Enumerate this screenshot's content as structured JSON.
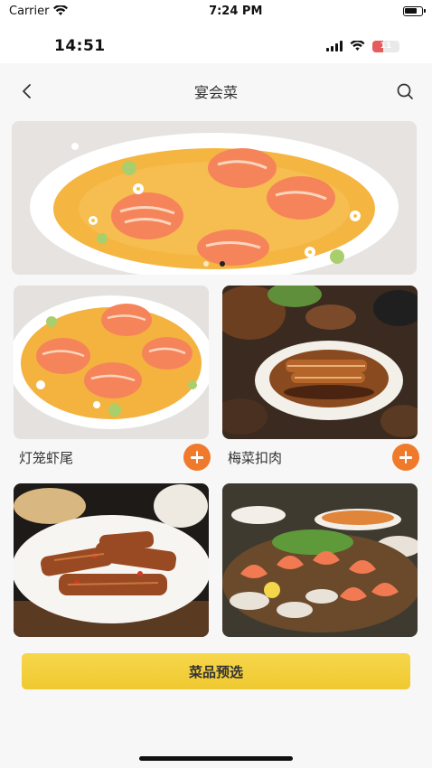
{
  "simulator_bar": {
    "carrier": "Carrier",
    "time": "7:24 PM"
  },
  "status_bar": {
    "time": "14:51",
    "battery": "11"
  },
  "nav": {
    "title": "宴会菜",
    "back_icon": "chevron-left-icon",
    "search_icon": "search-icon"
  },
  "banner": {
    "page_count": 2,
    "active_index": 1
  },
  "dishes": [
    {
      "name": "灯笼虾尾"
    },
    {
      "name": "梅菜扣肉"
    }
  ],
  "footer": {
    "button_label": "菜品预选"
  },
  "colors": {
    "accent_orange": "#f07a2c",
    "cta_yellow": "#f2cd3a"
  }
}
